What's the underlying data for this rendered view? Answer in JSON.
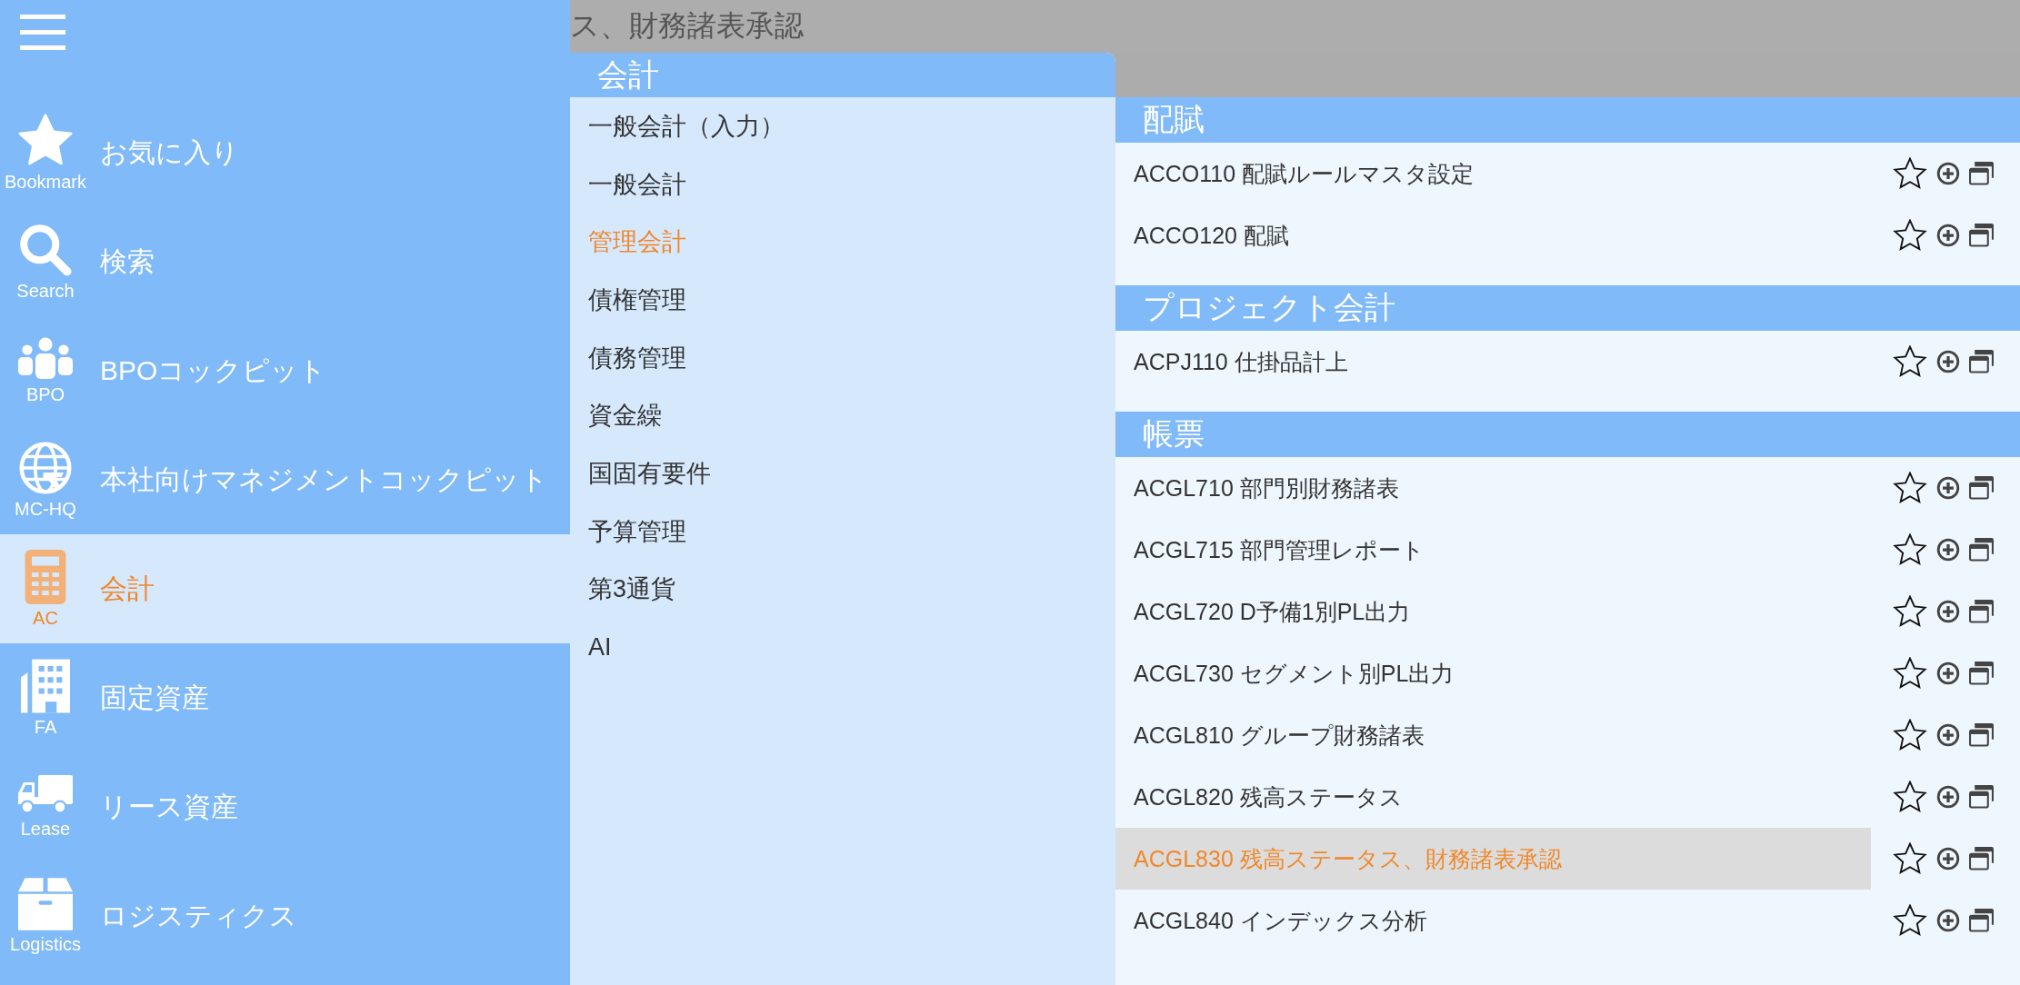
{
  "top_bar": {
    "title": "ス、財務諸表承認"
  },
  "sidebar": {
    "items": [
      {
        "kind": "star",
        "caption": "Bookmark",
        "label": "お気に入り",
        "selected": false
      },
      {
        "kind": "search",
        "caption": "Search",
        "label": "検索",
        "selected": false
      },
      {
        "kind": "people",
        "caption": "BPO",
        "label": "BPOコックピット",
        "selected": false
      },
      {
        "kind": "globe",
        "caption": "MC-HQ",
        "label": "本社向けマネジメントコックピット",
        "selected": false
      },
      {
        "kind": "calculator",
        "caption": "AC",
        "label": "会計",
        "selected": true
      },
      {
        "kind": "building",
        "caption": "FA",
        "label": "固定資産",
        "selected": false
      },
      {
        "kind": "truck",
        "caption": "Lease",
        "label": "リース資産",
        "selected": false
      },
      {
        "kind": "box",
        "caption": "Logistics",
        "label": "ロジスティクス",
        "selected": false
      }
    ]
  },
  "submenu": {
    "title": "会計",
    "items": [
      {
        "label": "一般会計（入力）",
        "selected": false
      },
      {
        "label": "一般会計",
        "selected": false
      },
      {
        "label": "管理会計",
        "selected": true
      },
      {
        "label": "債権管理",
        "selected": false
      },
      {
        "label": "債務管理",
        "selected": false
      },
      {
        "label": "資金繰",
        "selected": false
      },
      {
        "label": "国固有要件",
        "selected": false
      },
      {
        "label": "予算管理",
        "selected": false
      },
      {
        "label": "第3通貨",
        "selected": false
      },
      {
        "label": "AI",
        "selected": false
      }
    ]
  },
  "sections": [
    {
      "title": "配賦",
      "rows": [
        {
          "label": "ACCO110 配賦ルールマスタ設定",
          "selected": false
        },
        {
          "label": "ACCO120 配賦",
          "selected": false
        }
      ]
    },
    {
      "title": "プロジェクト会計",
      "rows": [
        {
          "label": "ACPJ110 仕掛品計上",
          "selected": false
        }
      ]
    },
    {
      "title": "帳票",
      "rows": [
        {
          "label": "ACGL710 部門別財務諸表",
          "selected": false
        },
        {
          "label": "ACGL715 部門管理レポート",
          "selected": false
        },
        {
          "label": "ACGL720 D予備1別PL出力",
          "selected": false
        },
        {
          "label": "ACGL730 セグメント別PL出力",
          "selected": false
        },
        {
          "label": "ACGL810 グループ財務諸表",
          "selected": false
        },
        {
          "label": "ACGL820 残高ステータス",
          "selected": false
        },
        {
          "label": "ACGL830 残高ステータス、財務諸表承認",
          "selected": true
        },
        {
          "label": "ACGL840 インデックス分析",
          "selected": false
        }
      ]
    }
  ]
}
